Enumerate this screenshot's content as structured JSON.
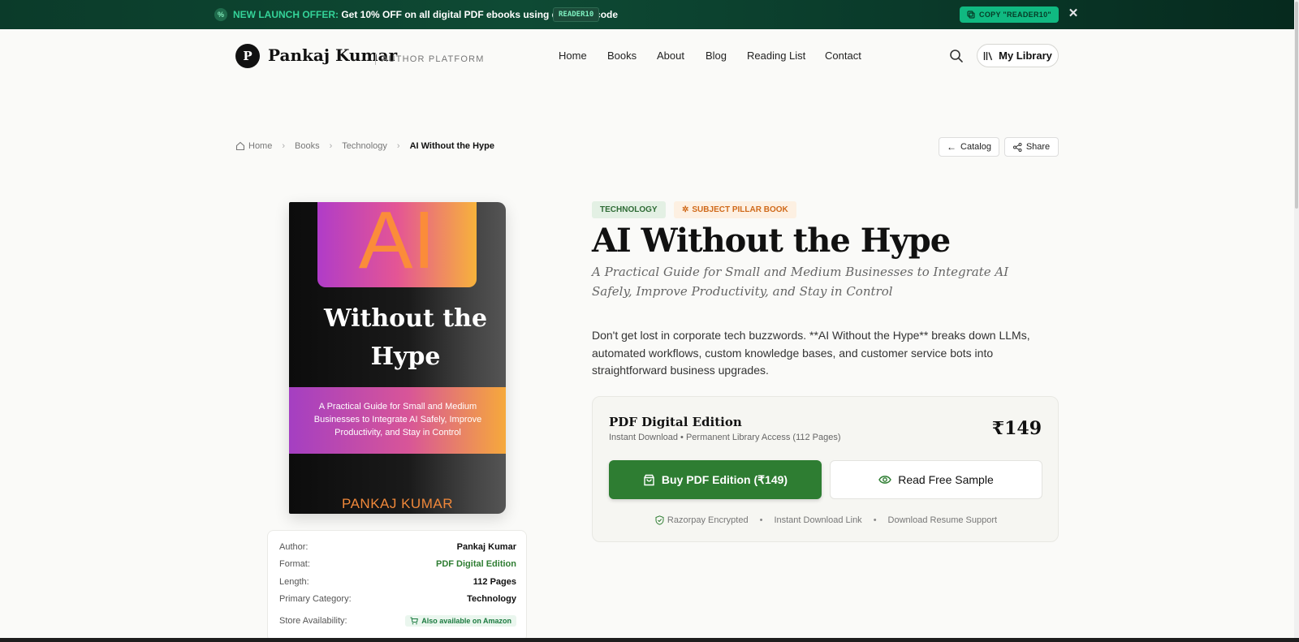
{
  "promo": {
    "highlight": "NEW LAUNCH OFFER:",
    "message": " Get 10% OFF on all digital PDF ebooks using discount code",
    "code": "READER10",
    "copy_label": "COPY \"READER10\"",
    "close_label": "✕"
  },
  "header": {
    "logo_letter": "P",
    "brand": "Pankaj Kumar",
    "brand_sub": "AUTHOR PLATFORM",
    "nav": [
      "Home",
      "Books",
      "About",
      "Blog",
      "Reading List",
      "Contact"
    ],
    "my_library": "My Library"
  },
  "breadcrumb": {
    "items": [
      "Home",
      "Books",
      "Technology"
    ],
    "current": "AI Without the Hype",
    "catalog": "Catalog",
    "share": "Share"
  },
  "cover": {
    "ai": "AI",
    "title_line1": "Without the",
    "title_line2": "Hype",
    "band_text": "A Practical Guide for Small and Medium Businesses to Integrate AI Safely, Improve Productivity, and Stay in Control",
    "author": "PANKAJ KUMAR"
  },
  "details": {
    "author_label": "Author:",
    "author_value": "Pankaj Kumar",
    "format_label": "Format:",
    "format_value": "PDF Digital Edition",
    "length_label": "Length:",
    "length_value": "112 Pages",
    "category_label": "Primary Category:",
    "category_value": "Technology",
    "store_label": "Store Availability:",
    "store_value": "Also available on Amazon"
  },
  "book": {
    "tag_category": "TECHNOLOGY",
    "tag_pillar": "SUBJECT PILLAR BOOK",
    "title": "AI Without the Hype",
    "subtitle": "A Practical Guide for Small and Medium Businesses to Integrate AI Safely, Improve Productivity, and Stay in Control",
    "description": "Don't get lost in corporate tech buzzwords. **AI Without the Hype** breaks down LLMs, automated workflows, custom knowledge bases, and customer service bots into straightforward business upgrades."
  },
  "purchase": {
    "edition_title": "PDF Digital Edition",
    "edition_sub": "Instant Download • Permanent Library Access (112 Pages)",
    "price": "₹149",
    "buy_label": "Buy PDF Edition (₹149)",
    "sample_label": "Read Free Sample",
    "trust": [
      "Razorpay Encrypted",
      "Instant Download Link",
      "Download Resume Support"
    ]
  },
  "colors": {
    "primary_green": "#2e7d32",
    "promo_bg": "#0e4a34",
    "copy_button": "#10b981",
    "pillar_orange": "#d06a1a"
  }
}
